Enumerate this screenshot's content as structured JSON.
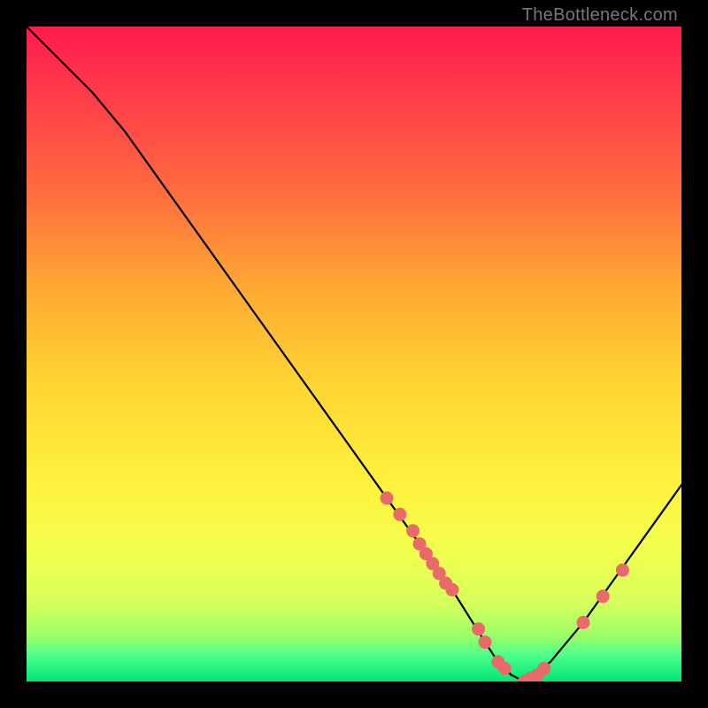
{
  "watermark": "TheBottleneck.com",
  "colors": {
    "dot": "#e86a6a",
    "curve": "#000000"
  },
  "chart_data": {
    "type": "line",
    "title": "",
    "xlabel": "",
    "ylabel": "",
    "xlim": [
      0,
      100
    ],
    "ylim": [
      0,
      100
    ],
    "grid": false,
    "legend": null,
    "series": [
      {
        "name": "curve",
        "x": [
          0,
          5,
          10,
          15,
          20,
          25,
          30,
          35,
          40,
          45,
          50,
          55,
          60,
          65,
          70,
          72,
          74,
          76,
          80,
          85,
          90,
          95,
          100
        ],
        "y": [
          100,
          95,
          90,
          84,
          77,
          70,
          63,
          56,
          49,
          42,
          35,
          28,
          21,
          14,
          6,
          3,
          1,
          0,
          3,
          9,
          16,
          23,
          30
        ]
      }
    ],
    "markers": {
      "name": "highlight-points",
      "x": [
        55,
        57,
        59,
        60,
        61,
        62,
        63,
        64,
        65,
        69,
        70,
        72,
        73,
        76,
        77,
        78,
        79,
        85,
        88,
        91
      ],
      "y": [
        28,
        25.5,
        23,
        21,
        19.5,
        18,
        16.5,
        15,
        14,
        8,
        6,
        3,
        2,
        0,
        0.5,
        1,
        2,
        9,
        13,
        17
      ]
    }
  }
}
